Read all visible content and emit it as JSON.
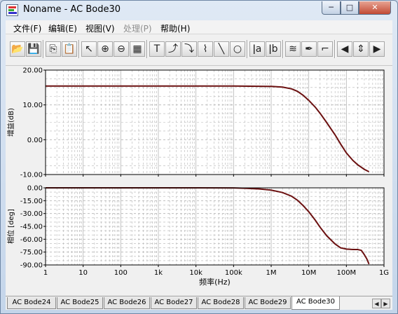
{
  "window": {
    "title": "Noname - AC Bode30",
    "minimize_glyph": "─",
    "maximize_glyph": "□",
    "close_glyph": "✕"
  },
  "menu": [
    {
      "label": "文件(F)",
      "enabled": true
    },
    {
      "label": "编辑(E)",
      "enabled": true
    },
    {
      "label": "视图(V)",
      "enabled": true
    },
    {
      "label": "处理(P)",
      "enabled": false
    },
    {
      "label": "帮助(H)",
      "enabled": true
    }
  ],
  "toolbar": [
    {
      "icon": "open-folder-icon",
      "glyph": "📂"
    },
    {
      "icon": "save-icon",
      "glyph": "💾"
    },
    {
      "sep": true
    },
    {
      "icon": "copy-icon",
      "glyph": "⎘"
    },
    {
      "icon": "paste-icon",
      "glyph": "📋"
    },
    {
      "sep": true
    },
    {
      "icon": "pointer-icon",
      "glyph": "↖"
    },
    {
      "icon": "zoom-in-icon",
      "glyph": "⊕"
    },
    {
      "icon": "zoom-100-icon",
      "glyph": "⊖"
    },
    {
      "icon": "grid-icon",
      "glyph": "▦"
    },
    {
      "sep": true
    },
    {
      "icon": "text-tool-icon",
      "glyph": "T"
    },
    {
      "icon": "label-arrow-icon",
      "glyph": "⤴"
    },
    {
      "icon": "label-point-icon",
      "glyph": "⤵"
    },
    {
      "icon": "line-segments-icon",
      "glyph": "⌇"
    },
    {
      "icon": "line-tool-icon",
      "glyph": "╲"
    },
    {
      "icon": "ellipse-tool-icon",
      "glyph": "○"
    },
    {
      "sep": true
    },
    {
      "icon": "cursor-a-icon",
      "glyph": "ǀa"
    },
    {
      "icon": "cursor-b-icon",
      "glyph": "ǀb"
    },
    {
      "sep": true
    },
    {
      "icon": "traces-icon",
      "glyph": "≋"
    },
    {
      "icon": "eyedropper-icon",
      "glyph": "✒"
    },
    {
      "icon": "step-icon",
      "glyph": "⌐"
    },
    {
      "sep": true
    },
    {
      "icon": "arrow-left-icon",
      "glyph": "◀"
    },
    {
      "icon": "arrow-updown-icon",
      "glyph": "⇕"
    },
    {
      "icon": "arrow-right-icon",
      "glyph": "▶"
    }
  ],
  "tabs": {
    "items": [
      "AC Bode24",
      "AC Bode25",
      "AC Bode26",
      "AC Bode27",
      "AC Bode28",
      "AC Bode29",
      "AC Bode30"
    ],
    "active": 6,
    "prev_glyph": "◀",
    "next_glyph": "▶"
  },
  "colors": {
    "trace": "#6b1010",
    "grid": "#b4b4b4"
  },
  "chart_data": [
    {
      "type": "line",
      "ylabel": "增益(dB)",
      "x_scale": "log",
      "xlim": [
        1,
        1000000000
      ],
      "ylim": [
        -10,
        20
      ],
      "y_ticks": [
        "20.00",
        "10.00",
        "0.00",
        "-10.00"
      ],
      "y_tick_values": [
        20,
        10,
        0,
        -10
      ],
      "grid": true,
      "series": [
        {
          "x": [
            1,
            10,
            100,
            1000,
            10000,
            100000,
            1000000,
            2000000,
            3500000,
            5000000,
            7000000,
            10000000,
            15000000,
            20000000,
            30000000,
            50000000,
            70000000,
            100000000,
            150000000,
            200000000,
            300000000,
            400000000
          ],
          "y": [
            15.4,
            15.4,
            15.4,
            15.4,
            15.4,
            15.4,
            15.3,
            15.1,
            14.6,
            13.9,
            12.8,
            11.3,
            9.3,
            7.6,
            4.9,
            1.4,
            -1.2,
            -3.8,
            -6.0,
            -7.2,
            -8.5,
            -9.2
          ]
        }
      ]
    },
    {
      "type": "line",
      "ylabel": "相位 [deg]",
      "xlabel": "频率(Hz)",
      "x_scale": "log",
      "xlim": [
        1,
        1000000000
      ],
      "ylim": [
        -90,
        0
      ],
      "x_ticks": [
        "1",
        "10",
        "100",
        "1k",
        "10k",
        "100k",
        "1M",
        "10M",
        "100M",
        "1G"
      ],
      "x_tick_values": [
        1,
        10,
        100,
        1000,
        10000,
        100000,
        1000000,
        10000000,
        100000000,
        1000000000
      ],
      "y_ticks": [
        "0.00",
        "-15.00",
        "-30.00",
        "-45.00",
        "-60.00",
        "-75.00",
        "-90.00"
      ],
      "y_tick_values": [
        0,
        -15,
        -30,
        -45,
        -60,
        -75,
        -90
      ],
      "grid": true,
      "series": [
        {
          "x": [
            1,
            10,
            100,
            1000,
            10000,
            100000,
            200000,
            500000,
            1000000,
            2000000,
            3500000,
            5000000,
            7000000,
            10000000,
            15000000,
            20000000,
            30000000,
            50000000,
            70000000,
            100000000,
            150000000,
            200000000,
            250000000,
            300000000,
            350000000,
            400000000
          ],
          "y": [
            0,
            0,
            0,
            0,
            0,
            -0.1,
            -0.5,
            -1.3,
            -2.7,
            -5.5,
            -9.8,
            -14.5,
            -20.5,
            -28,
            -38,
            -46,
            -56,
            -65.5,
            -70,
            -71.5,
            -72,
            -72,
            -73,
            -78,
            -83,
            -89
          ]
        }
      ]
    }
  ]
}
